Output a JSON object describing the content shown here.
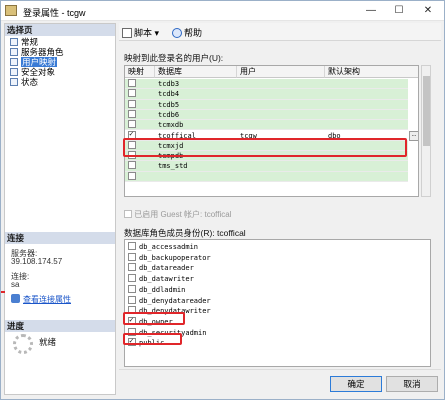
{
  "window": {
    "title": "登录属性 - tcgw"
  },
  "title_controls": {
    "minimize": "—",
    "maximize": "☐",
    "close": "✕"
  },
  "left": {
    "select_page_header": "选择页",
    "pages": [
      {
        "label": "常规",
        "selected": false
      },
      {
        "label": "服务器角色",
        "selected": false
      },
      {
        "label": "用户映射",
        "selected": true
      },
      {
        "label": "安全对象",
        "selected": false
      },
      {
        "label": "状态",
        "selected": false
      }
    ],
    "connection_header": "连接",
    "server_label": "服务器:",
    "server_value": "39.108.174.57",
    "connection_label": "连接:",
    "connection_value": "sa",
    "view_conn_link": "查看连接属性",
    "progress_header": "进度",
    "progress_status": "就绪"
  },
  "toolbar": {
    "script_label": "脚本",
    "script_arrow": "▾",
    "help_label": "帮助"
  },
  "mapping": {
    "label": "映射到此登录名的用户(U):",
    "columns": [
      "映射",
      "数据库",
      "用户",
      "默认架构"
    ],
    "rows": [
      {
        "mapped": false,
        "database": "tcdb3",
        "user": "",
        "schema": "",
        "green": true
      },
      {
        "mapped": false,
        "database": "tcdb4",
        "user": "",
        "schema": "",
        "green": true
      },
      {
        "mapped": false,
        "database": "tcdb5",
        "user": "",
        "schema": "",
        "green": true
      },
      {
        "mapped": false,
        "database": "tcdb6",
        "user": "",
        "schema": "",
        "green": true
      },
      {
        "mapped": false,
        "database": "tcmxdb",
        "user": "",
        "schema": "",
        "green": true
      },
      {
        "mapped": true,
        "database": "tcoffical",
        "user": "tcgw",
        "schema": "dbo",
        "green": false
      },
      {
        "mapped": false,
        "database": "tcmxjd",
        "user": "",
        "schema": "",
        "green": true
      },
      {
        "mapped": false,
        "database": "tempdb",
        "user": "",
        "schema": "",
        "green": true
      },
      {
        "mapped": false,
        "database": "tms_std",
        "user": "",
        "schema": "",
        "green": true
      },
      {
        "mapped": false,
        "database": "",
        "user": "",
        "schema": "",
        "green": true
      }
    ],
    "ellipsis": "..."
  },
  "guest": {
    "label": "已启用 Guest 帐户: tcoffical"
  },
  "roles": {
    "label": "数据库角色成员身份(R): tcoffical",
    "items": [
      {
        "name": "db_accessadmin",
        "checked": false
      },
      {
        "name": "db_backupoperator",
        "checked": false
      },
      {
        "name": "db_datareader",
        "checked": false
      },
      {
        "name": "db_datawriter",
        "checked": false
      },
      {
        "name": "db_ddladmin",
        "checked": false
      },
      {
        "name": "db_denydatareader",
        "checked": false
      },
      {
        "name": "db_denydatawriter",
        "checked": false
      },
      {
        "name": "db_owner",
        "checked": true
      },
      {
        "name": "db_securityadmin",
        "checked": false
      },
      {
        "name": "public",
        "checked": true
      }
    ]
  },
  "buttons": {
    "ok": "确定",
    "cancel": "取消"
  },
  "colors": {
    "highlight_red": "#e0262a",
    "mapped_green": "#d8f0d6",
    "selection_blue": "#3a7bd5"
  }
}
